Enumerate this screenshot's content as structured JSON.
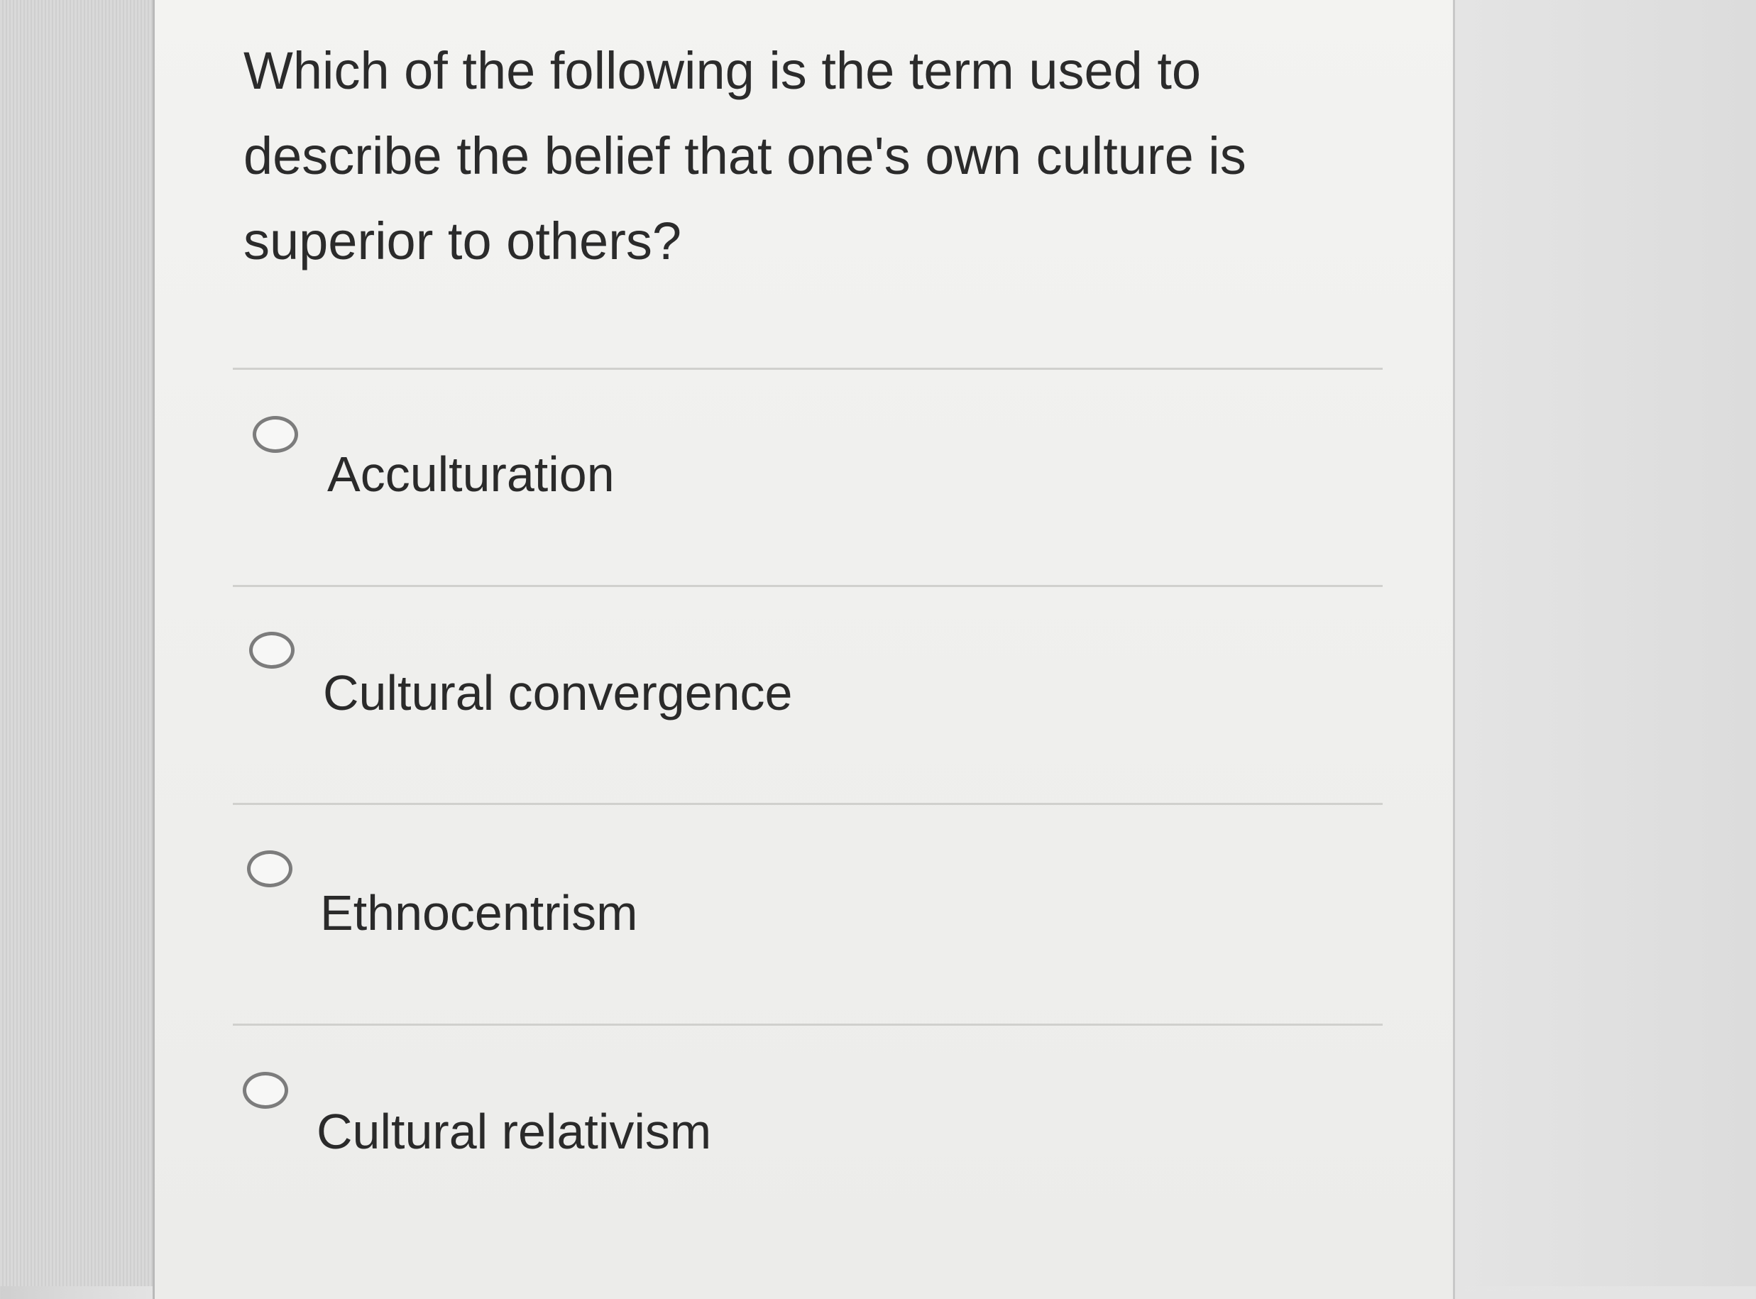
{
  "question": {
    "text": "Which of the following is the term used to describe the belief that one's own culture is superior to others?"
  },
  "options": [
    {
      "label": "Acculturation",
      "selected": false
    },
    {
      "label": "Cultural convergence",
      "selected": false
    },
    {
      "label": "Ethnocentrism",
      "selected": false
    },
    {
      "label": "Cultural relativism",
      "selected": false
    }
  ]
}
